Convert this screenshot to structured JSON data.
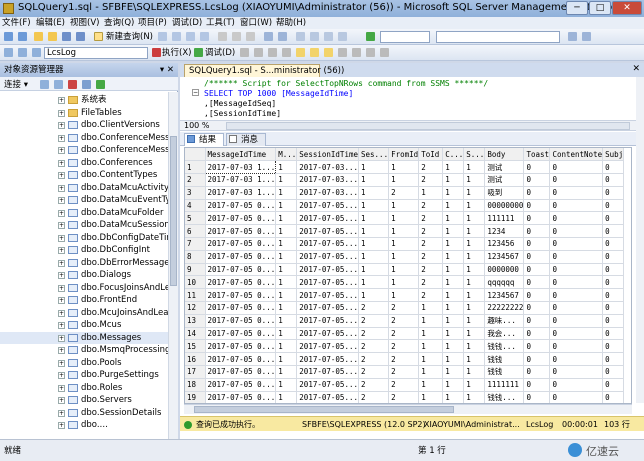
{
  "window": {
    "title": "SQLQuery1.sql - SFBFE\\SQLEXPRESS.LcsLog (XIAOYUMI\\Administrator (56)) - Microsoft SQL Server Management Studio(…",
    "min_label": "─",
    "max_label": "□",
    "close_label": "✕"
  },
  "menu": [
    "文件(F)",
    "编辑(E)",
    "视图(V)",
    "查询(Q)",
    "项目(P)",
    "调试(D)",
    "工具(T)",
    "窗口(W)",
    "帮助(H)"
  ],
  "toolbar1": {
    "new_query": "新建查询(N)"
  },
  "toolbar2": {
    "database": "LcsLog",
    "execute": "执行(X)",
    "debug": "调试(D)"
  },
  "object_explorer": {
    "title": "对象资源管理器",
    "pin": "▾ ✕",
    "connect_label": "连接 ▾",
    "items": [
      "系统表",
      "FileTables",
      "dbo.ClientVersions",
      "dbo.ConferenceMessage",
      "dbo.ConferenceMessage",
      "dbo.Conferences",
      "dbo.ContentTypes",
      "dbo.DataMcuActivity",
      "dbo.DataMcuEventTypes",
      "dbo.DataMcuFolder",
      "dbo.DataMcuSessions",
      "dbo.DbConfigDateTime",
      "dbo.DbConfigInt",
      "dbo.DbErrorMessage",
      "dbo.Dialogs",
      "dbo.FocusJoinsAndLeave",
      "dbo.FrontEnd",
      "dbo.McuJoinsAndLeaves",
      "dbo.Mcus",
      "dbo.Messages",
      "dbo.MsmqProcessing",
      "dbo.Pools",
      "dbo.PurgeSettings",
      "dbo.Roles",
      "dbo.Servers",
      "dbo.SessionDetails",
      "dbo.…"
    ]
  },
  "editor": {
    "tab_label": "SQLQuery1.sql - S...ministrator (56))",
    "code_lines": [
      "/****** Script for SelectTopNRows command from SSMS  ******/",
      "SELECT TOP 1000 [MessageIdTime]",
      "      ,[MessageIdSeq]",
      "      ,[SessionIdTime]"
    ],
    "zoom": "100 %",
    "results_tab": "结果",
    "messages_tab": "消息"
  },
  "grid": {
    "columns": [
      "",
      "MessageIdTime",
      "M...",
      "SessionIdTime",
      "Ses...",
      "FromId",
      "ToId",
      "C...",
      "S...",
      "Body",
      "Toast",
      "ContentNote",
      "Subj"
    ],
    "rows": [
      [
        "1",
        "2017-07-03 1...",
        "1",
        "2017-07-03...",
        "1",
        "1",
        "2",
        "1",
        "1",
        "测试",
        "0",
        "0",
        "0"
      ],
      [
        "2",
        "2017-07-03 1...",
        "1",
        "2017-07-03...",
        "1",
        "1",
        "2",
        "1",
        "1",
        "测试",
        "0",
        "0",
        "0"
      ],
      [
        "3",
        "2017-07-03 1...",
        "1",
        "2017-07-03...",
        "1",
        "2",
        "1",
        "1",
        "1",
        "吸到",
        "0",
        "0",
        "0"
      ],
      [
        "4",
        "2017-07-05 0...",
        "1",
        "2017-07-05...",
        "1",
        "1",
        "2",
        "1",
        "1",
        "00000000",
        "0",
        "0",
        "0"
      ],
      [
        "5",
        "2017-07-05 0...",
        "1",
        "2017-07-05...",
        "1",
        "1",
        "2",
        "1",
        "1",
        "111111",
        "0",
        "0",
        "0"
      ],
      [
        "6",
        "2017-07-05 0...",
        "1",
        "2017-07-05...",
        "1",
        "1",
        "2",
        "1",
        "1",
        "1234",
        "0",
        "0",
        "0"
      ],
      [
        "7",
        "2017-07-05 0...",
        "1",
        "2017-07-05...",
        "1",
        "1",
        "2",
        "1",
        "1",
        "123456",
        "0",
        "0",
        "0"
      ],
      [
        "8",
        "2017-07-05 0...",
        "1",
        "2017-07-05...",
        "1",
        "1",
        "2",
        "1",
        "1",
        "1234567",
        "0",
        "0",
        "0"
      ],
      [
        "9",
        "2017-07-05 0...",
        "1",
        "2017-07-05...",
        "1",
        "1",
        "2",
        "1",
        "1",
        "0000000",
        "0",
        "0",
        "0"
      ],
      [
        "10",
        "2017-07-05 0...",
        "1",
        "2017-07-05...",
        "1",
        "1",
        "2",
        "1",
        "1",
        "qqqqqq",
        "0",
        "0",
        "0"
      ],
      [
        "11",
        "2017-07-05 0...",
        "1",
        "2017-07-05...",
        "1",
        "1",
        "2",
        "1",
        "1",
        "1234567",
        "0",
        "0",
        "0"
      ],
      [
        "12",
        "2017-07-05 0...",
        "1",
        "2017-07-05...",
        "2",
        "2",
        "1",
        "1",
        "1",
        "22222222",
        "0",
        "0",
        "0"
      ],
      [
        "13",
        "2017-07-05 0...",
        "1",
        "2017-07-05...",
        "2",
        "2",
        "1",
        "1",
        "1",
        "趣味...",
        "0",
        "0",
        "0"
      ],
      [
        "14",
        "2017-07-05 0...",
        "1",
        "2017-07-05...",
        "2",
        "2",
        "1",
        "1",
        "1",
        "我会...",
        "0",
        "0",
        "0"
      ],
      [
        "15",
        "2017-07-05 0...",
        "1",
        "2017-07-05...",
        "2",
        "2",
        "1",
        "1",
        "1",
        "钱钱...",
        "0",
        "0",
        "0"
      ],
      [
        "16",
        "2017-07-05 0...",
        "1",
        "2017-07-05...",
        "2",
        "2",
        "1",
        "1",
        "1",
        "钱钱",
        "0",
        "0",
        "0"
      ],
      [
        "17",
        "2017-07-05 0...",
        "1",
        "2017-07-05...",
        "2",
        "2",
        "1",
        "1",
        "1",
        "钱钱",
        "0",
        "0",
        "0"
      ],
      [
        "18",
        "2017-07-05 0...",
        "1",
        "2017-07-05...",
        "2",
        "2",
        "1",
        "1",
        "1",
        "1111111",
        "0",
        "0",
        "0"
      ],
      [
        "19",
        "2017-07-05 0...",
        "1",
        "2017-07-05...",
        "2",
        "2",
        "1",
        "1",
        "1",
        "钱钱...",
        "0",
        "0",
        "0"
      ]
    ]
  },
  "query_status": {
    "message": "查询已成功执行。",
    "server": "SFBFE\\SQLEXPRESS (12.0 SP2)",
    "user": "XIAOYUMI\\Administrat...",
    "database": "LcsLog",
    "elapsed": "00:00:01",
    "rows": "103 行"
  },
  "statusbar": {
    "ready": "就绪",
    "line": "第 1 行",
    "watermark": "亿速云"
  },
  "colors": {
    "accent": "#8fb0da",
    "status_yellow": "#f8e9a1",
    "keyword_blue": "#0000ff",
    "comment_green": "#008000"
  }
}
